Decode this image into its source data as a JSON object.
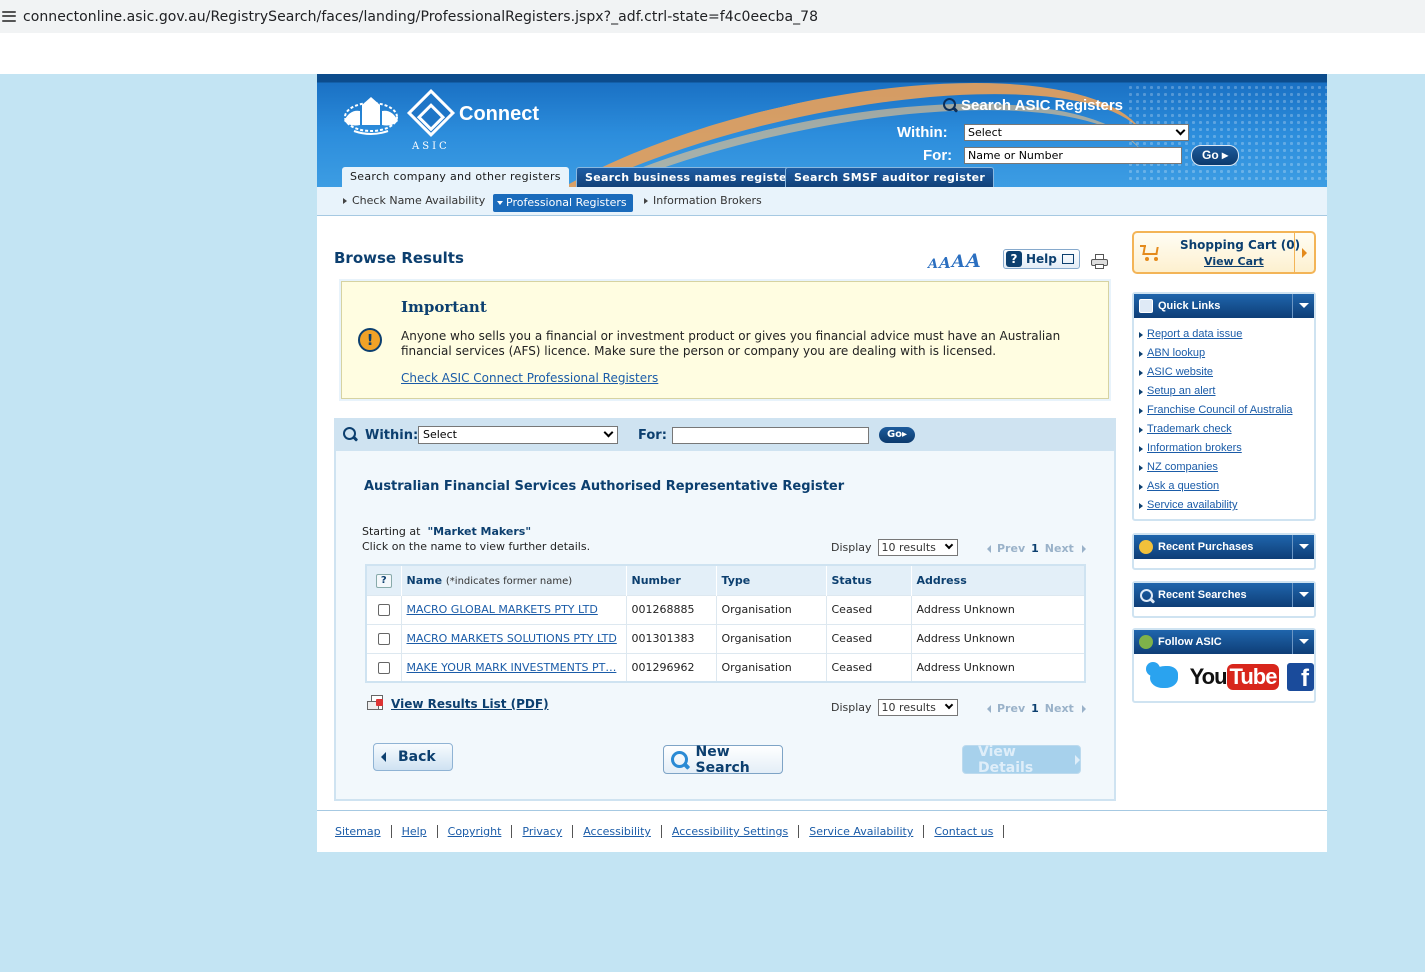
{
  "browser": {
    "url": "connectonline.asic.gov.au/RegistrySearch/faces/landing/ProfessionalRegisters.jspx?_adf.ctrl-state=f4c0eecba_78"
  },
  "header": {
    "brand": "Connect",
    "crest_text": "ASIC",
    "search_title": "Search ASIC Registers",
    "within_label": "Within:",
    "within_value": "Select",
    "for_label": "For:",
    "for_value": "Name or Number",
    "go_label": "Go"
  },
  "main_tabs": [
    {
      "label": "Search company and other registers",
      "active": true
    },
    {
      "label": "Search business names register",
      "active": false
    },
    {
      "label": "Search SMSF auditor register",
      "active": false
    }
  ],
  "subnav": [
    {
      "label": "Check Name Availability",
      "active": false
    },
    {
      "label": "Professional Registers",
      "active": true
    },
    {
      "label": "Information Brokers",
      "active": false
    }
  ],
  "page": {
    "title": "Browse Results",
    "font_size_glyph": "A",
    "help_label": "Help"
  },
  "important": {
    "icon": "!",
    "title": "Important",
    "body": "Anyone who sells you a financial or investment product or gives you financial advice must have an Australian financial services (AFS) licence. Make sure the person or company you are dealing with is licensed.",
    "link": "Check ASIC Connect Professional Registers"
  },
  "search_panel": {
    "within_label": "Within:",
    "within_value": "Select",
    "for_label": "For:",
    "for_value": "",
    "go_label": "Go"
  },
  "results": {
    "register_title": "Australian Financial Services Authorised Representative Register",
    "starting_at_prefix": "Starting at",
    "starting_at_value": "\"Market Makers\"",
    "hint": "Click on the name to view further details.",
    "display_label": "Display",
    "display_value": "10 results",
    "prev_label": "Prev",
    "current_page": "1",
    "next_label": "Next",
    "help_glyph": "?",
    "columns": {
      "name": "Name",
      "name_note": "(*indicates former name)",
      "number": "Number",
      "type": "Type",
      "status": "Status",
      "address": "Address"
    },
    "rows": [
      {
        "name": "MACRO GLOBAL MARKETS PTY LTD",
        "number": "001268885",
        "type": "Organisation",
        "status": "Ceased",
        "address": "Address Unknown"
      },
      {
        "name": "MACRO MARKETS SOLUTIONS PTY LTD",
        "number": "001301383",
        "type": "Organisation",
        "status": "Ceased",
        "address": "Address Unknown"
      },
      {
        "name": "MAKE YOUR MARK INVESTMENTS PT…",
        "number": "001296962",
        "type": "Organisation",
        "status": "Ceased",
        "address": "Address Unknown"
      }
    ],
    "pdf_link": "View Results List (PDF)",
    "back_label": "Back",
    "new_search_label": "New Search",
    "view_details_label": "View Details"
  },
  "footer": {
    "links": [
      "Sitemap",
      "Help",
      "Copyright",
      "Privacy",
      "Accessibility",
      "Accessibility Settings",
      "Service Availability",
      "Contact us"
    ]
  },
  "sidebar": {
    "cart_title": "Shopping Cart (0)",
    "cart_link": "View Cart",
    "quick_links_title": "Quick Links",
    "quick_links": [
      "Report a data issue",
      "ABN lookup",
      "ASIC website",
      "Setup an alert",
      "Franchise Council of Australia",
      "Trademark check",
      "Information brokers",
      "NZ companies",
      "Ask a question",
      "Service availability"
    ],
    "recent_purchases_title": "Recent Purchases",
    "recent_searches_title": "Recent Searches",
    "follow_title": "Follow ASIC",
    "social": [
      "twitter",
      "YouTube",
      "facebook"
    ],
    "youtube_you": "You",
    "youtube_tube": "Tube",
    "facebook_glyph": "f"
  },
  "colors": {
    "page_bg": "#c3e4f3",
    "brand_dark": "#0c3f6f",
    "link": "#1b5ca8",
    "important_bg": "#fffde1",
    "cart_border": "#f3b457"
  }
}
